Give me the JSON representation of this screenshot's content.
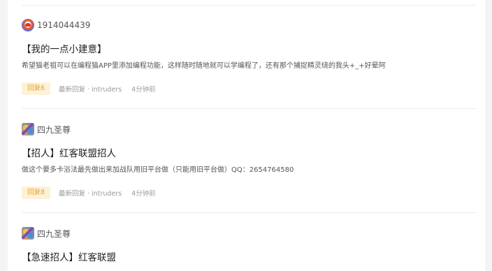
{
  "posts": [
    {
      "author": "1914044439",
      "avatar_icon": "mascot-avatar-icon",
      "title": "【我的一点小建意】",
      "body": "希望猫老祖可以在编程猫APP里添加编程功能，这样随时随地就可以学编程了，还有那个捕捉精灵绕的我头+_+好晕阿",
      "reply_label": "回复6",
      "latest_reply": "最新回复 · intruders",
      "time_ago": "4分钟前"
    },
    {
      "author": "四九圣尊",
      "avatar_icon": "character-avatar-icon",
      "title": "【招人】红客联盟招人",
      "body": "做这个要多卡浴法最先做出来加战队用旧平台做（只能用旧平台做）QQ：2654764580",
      "reply_label": "回复8",
      "latest_reply": "最新回复 · intruders",
      "time_ago": "4分钟前"
    },
    {
      "author": "四九圣尊",
      "avatar_icon": "character-avatar-icon",
      "title": "【急速招人】红客联盟"
    }
  ],
  "colors": {
    "reply_badge_bg": "#fdf2d8",
    "reply_badge_text": "#e8a32a",
    "divider": "#ececec"
  }
}
